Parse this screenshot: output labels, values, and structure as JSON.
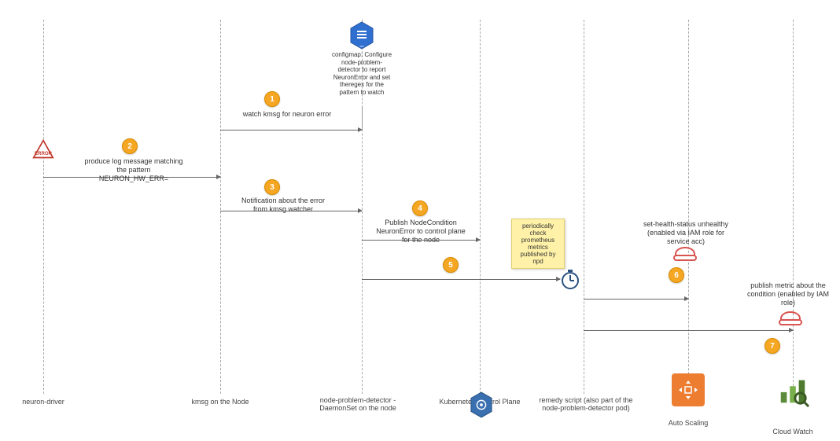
{
  "lanes": {
    "neuronDriver": {
      "label": "neuron-driver"
    },
    "kmsg": {
      "label": "kmsg on the Node"
    },
    "npd": {
      "label": "node-problem-detector -DaemonSet on the node"
    },
    "controlPlane": {
      "label": "Kubernetes Control Plane"
    },
    "remedy": {
      "label": "remedy script (also part of the node-problem-detector pod)"
    },
    "autoScaling": {
      "label": "Auto Scaling"
    },
    "cloudWatch": {
      "label": "Cloud Watch"
    }
  },
  "steps": {
    "s1": "1",
    "s2": "2",
    "s3": "3",
    "s4": "4",
    "s5": "5",
    "s6": "6",
    "s7": "7"
  },
  "messages": {
    "watchKmsg": "watch kmsg for neuron error",
    "produceLog": "produce log message matching the pattern NEURON_HW_ERR=",
    "notification": "Notification about the error from kmsg watcher",
    "publishNodeCondition": "Publish NodeCondition NeuronError to control plane for the node",
    "sticky": "periodically check prometheus metrics published by npd",
    "setHealth": "set-health-status unhealthy (enabled via IAM role for service acc)",
    "publishMetric": "publish metric about the condition (enabled by IAM role)",
    "configmap": "configmap: Configure node-problem-detector to report NeuronError and set theregex for the pattern to watch"
  },
  "icons": {
    "driver": "error-warning-triangle",
    "configmap": "kubernetes-configmap",
    "controlPlane": "kubernetes-hexagon",
    "clock": "stopwatch",
    "hardhat": "iam-role-hardhat",
    "autoscaling": "aws-auto-scaling",
    "cloudwatch": "aws-cloudwatch"
  }
}
